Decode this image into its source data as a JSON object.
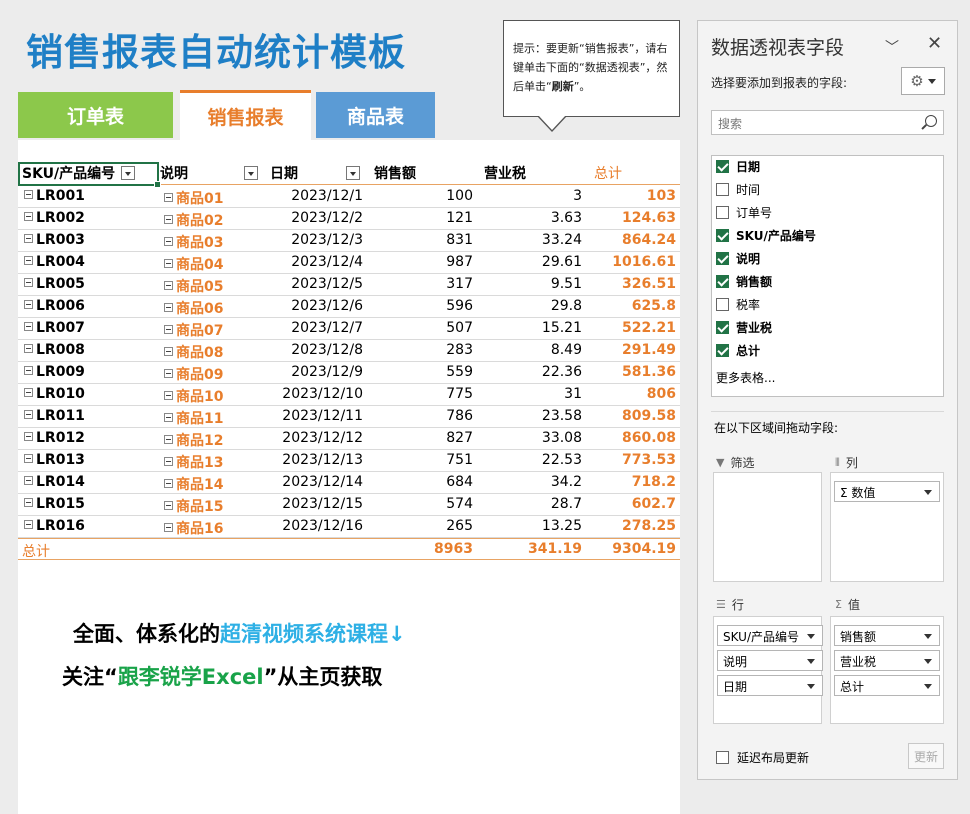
{
  "title": "销售报表自动统计模板",
  "tabs": {
    "order": "订单表",
    "sales": "销售报表",
    "goods": "商品表"
  },
  "tip": {
    "part1": "提示：要更新“销售报表”，请右键单击下面的“数据透视表”，然后单击“",
    "bold": "刷新",
    "part2": "”。"
  },
  "table": {
    "headers": {
      "sku": "SKU/产品编号",
      "desc": "说明",
      "date": "日期",
      "amount": "销售额",
      "tax": "营业税",
      "total": "总计"
    },
    "rows": [
      {
        "sku": "LR001",
        "desc": "商品01",
        "date": "2023/12/1",
        "amount": "100",
        "tax": "3",
        "total": "103"
      },
      {
        "sku": "LR002",
        "desc": "商品02",
        "date": "2023/12/2",
        "amount": "121",
        "tax": "3.63",
        "total": "124.63"
      },
      {
        "sku": "LR003",
        "desc": "商品03",
        "date": "2023/12/3",
        "amount": "831",
        "tax": "33.24",
        "total": "864.24"
      },
      {
        "sku": "LR004",
        "desc": "商品04",
        "date": "2023/12/4",
        "amount": "987",
        "tax": "29.61",
        "total": "1016.61"
      },
      {
        "sku": "LR005",
        "desc": "商品05",
        "date": "2023/12/5",
        "amount": "317",
        "tax": "9.51",
        "total": "326.51"
      },
      {
        "sku": "LR006",
        "desc": "商品06",
        "date": "2023/12/6",
        "amount": "596",
        "tax": "29.8",
        "total": "625.8"
      },
      {
        "sku": "LR007",
        "desc": "商品07",
        "date": "2023/12/7",
        "amount": "507",
        "tax": "15.21",
        "total": "522.21"
      },
      {
        "sku": "LR008",
        "desc": "商品08",
        "date": "2023/12/8",
        "amount": "283",
        "tax": "8.49",
        "total": "291.49"
      },
      {
        "sku": "LR009",
        "desc": "商品09",
        "date": "2023/12/9",
        "amount": "559",
        "tax": "22.36",
        "total": "581.36"
      },
      {
        "sku": "LR010",
        "desc": "商品10",
        "date": "2023/12/10",
        "amount": "775",
        "tax": "31",
        "total": "806"
      },
      {
        "sku": "LR011",
        "desc": "商品11",
        "date": "2023/12/11",
        "amount": "786",
        "tax": "23.58",
        "total": "809.58"
      },
      {
        "sku": "LR012",
        "desc": "商品12",
        "date": "2023/12/12",
        "amount": "827",
        "tax": "33.08",
        "total": "860.08"
      },
      {
        "sku": "LR013",
        "desc": "商品13",
        "date": "2023/12/13",
        "amount": "751",
        "tax": "22.53",
        "total": "773.53"
      },
      {
        "sku": "LR014",
        "desc": "商品14",
        "date": "2023/12/14",
        "amount": "684",
        "tax": "34.2",
        "total": "718.2"
      },
      {
        "sku": "LR015",
        "desc": "商品15",
        "date": "2023/12/15",
        "amount": "574",
        "tax": "28.7",
        "total": "602.7"
      },
      {
        "sku": "LR016",
        "desc": "商品16",
        "date": "2023/12/16",
        "amount": "265",
        "tax": "13.25",
        "total": "278.25"
      }
    ],
    "total": {
      "label": "总计",
      "amount": "8963",
      "tax": "341.19",
      "total": "9304.19"
    }
  },
  "promo": {
    "line1_a": "全面、体系化的",
    "line1_hl": "超清视频系统课程↓",
    "line2_a": "关注“",
    "line2_hl": "跟李锐学Excel",
    "line2_b": "”从主页获取"
  },
  "panel": {
    "title": "数据透视表字段",
    "subtitle": "选择要添加到报表的字段:",
    "search_placeholder": "搜索",
    "fields": [
      {
        "label": "日期",
        "checked": true
      },
      {
        "label": "时间",
        "checked": false
      },
      {
        "label": "订单号",
        "checked": false
      },
      {
        "label": "SKU/产品编号",
        "checked": true
      },
      {
        "label": "说明",
        "checked": true
      },
      {
        "label": "销售额",
        "checked": true
      },
      {
        "label": "税率",
        "checked": false
      },
      {
        "label": "营业税",
        "checked": true
      },
      {
        "label": "总计",
        "checked": true
      }
    ],
    "more_tables": "更多表格...",
    "drag_label": "在以下区域间拖动字段:",
    "areas": {
      "filter": {
        "label": "筛选",
        "items": []
      },
      "columns": {
        "label": "列",
        "items": [
          "Σ 数值"
        ]
      },
      "rows": {
        "label": "行",
        "items": [
          "SKU/产品编号",
          "说明",
          "日期"
        ]
      },
      "values": {
        "label": "值",
        "items": [
          "销售额",
          "营业税",
          "总计"
        ]
      }
    },
    "defer_label": "延迟布局更新",
    "update_label": "更新"
  },
  "colors": {
    "title": "#1f7fc6",
    "order_tab": "#8cc84b",
    "sales_tab": "#e87e2c",
    "goods_tab": "#5b9bd5",
    "accent_orange": "#e87e2c",
    "excel_green": "#217346"
  }
}
